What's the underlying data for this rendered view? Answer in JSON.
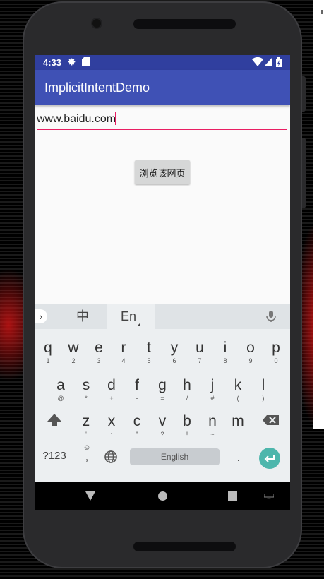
{
  "status_bar": {
    "time": "4:33"
  },
  "app_bar": {
    "title": "ImplicitIntentDemo"
  },
  "form": {
    "url_value": "www.baidu.com",
    "browse_button_label": "浏览该网页"
  },
  "keyboard": {
    "tabs": {
      "chinese": "中",
      "english": "En"
    },
    "rows": [
      [
        {
          "key": "q",
          "hint": "1"
        },
        {
          "key": "w",
          "hint": "2"
        },
        {
          "key": "e",
          "hint": "3"
        },
        {
          "key": "r",
          "hint": "4"
        },
        {
          "key": "t",
          "hint": "5"
        },
        {
          "key": "y",
          "hint": "6"
        },
        {
          "key": "u",
          "hint": "7"
        },
        {
          "key": "i",
          "hint": "8"
        },
        {
          "key": "o",
          "hint": "9"
        },
        {
          "key": "p",
          "hint": "0"
        }
      ],
      [
        {
          "key": "a",
          "hint": "@"
        },
        {
          "key": "s",
          "hint": "*"
        },
        {
          "key": "d",
          "hint": "+"
        },
        {
          "key": "f",
          "hint": "-"
        },
        {
          "key": "g",
          "hint": "="
        },
        {
          "key": "h",
          "hint": "/"
        },
        {
          "key": "j",
          "hint": "#"
        },
        {
          "key": "k",
          "hint": "("
        },
        {
          "key": "l",
          "hint": ")"
        }
      ],
      [
        {
          "key": "z",
          "hint": "'"
        },
        {
          "key": "x",
          "hint": ":"
        },
        {
          "key": "c",
          "hint": "\""
        },
        {
          "key": "v",
          "hint": "?"
        },
        {
          "key": "b",
          "hint": "!"
        },
        {
          "key": "n",
          "hint": "~"
        },
        {
          "key": "m",
          "hint": "…"
        }
      ]
    ],
    "symbols_label": "?123",
    "comma_label": ",",
    "space_label": "English",
    "period_label": "."
  },
  "colors": {
    "primary": "#3f51b5",
    "primary_dark": "#303f9f",
    "accent": "#e91e63",
    "enter_key": "#4db6ac"
  }
}
